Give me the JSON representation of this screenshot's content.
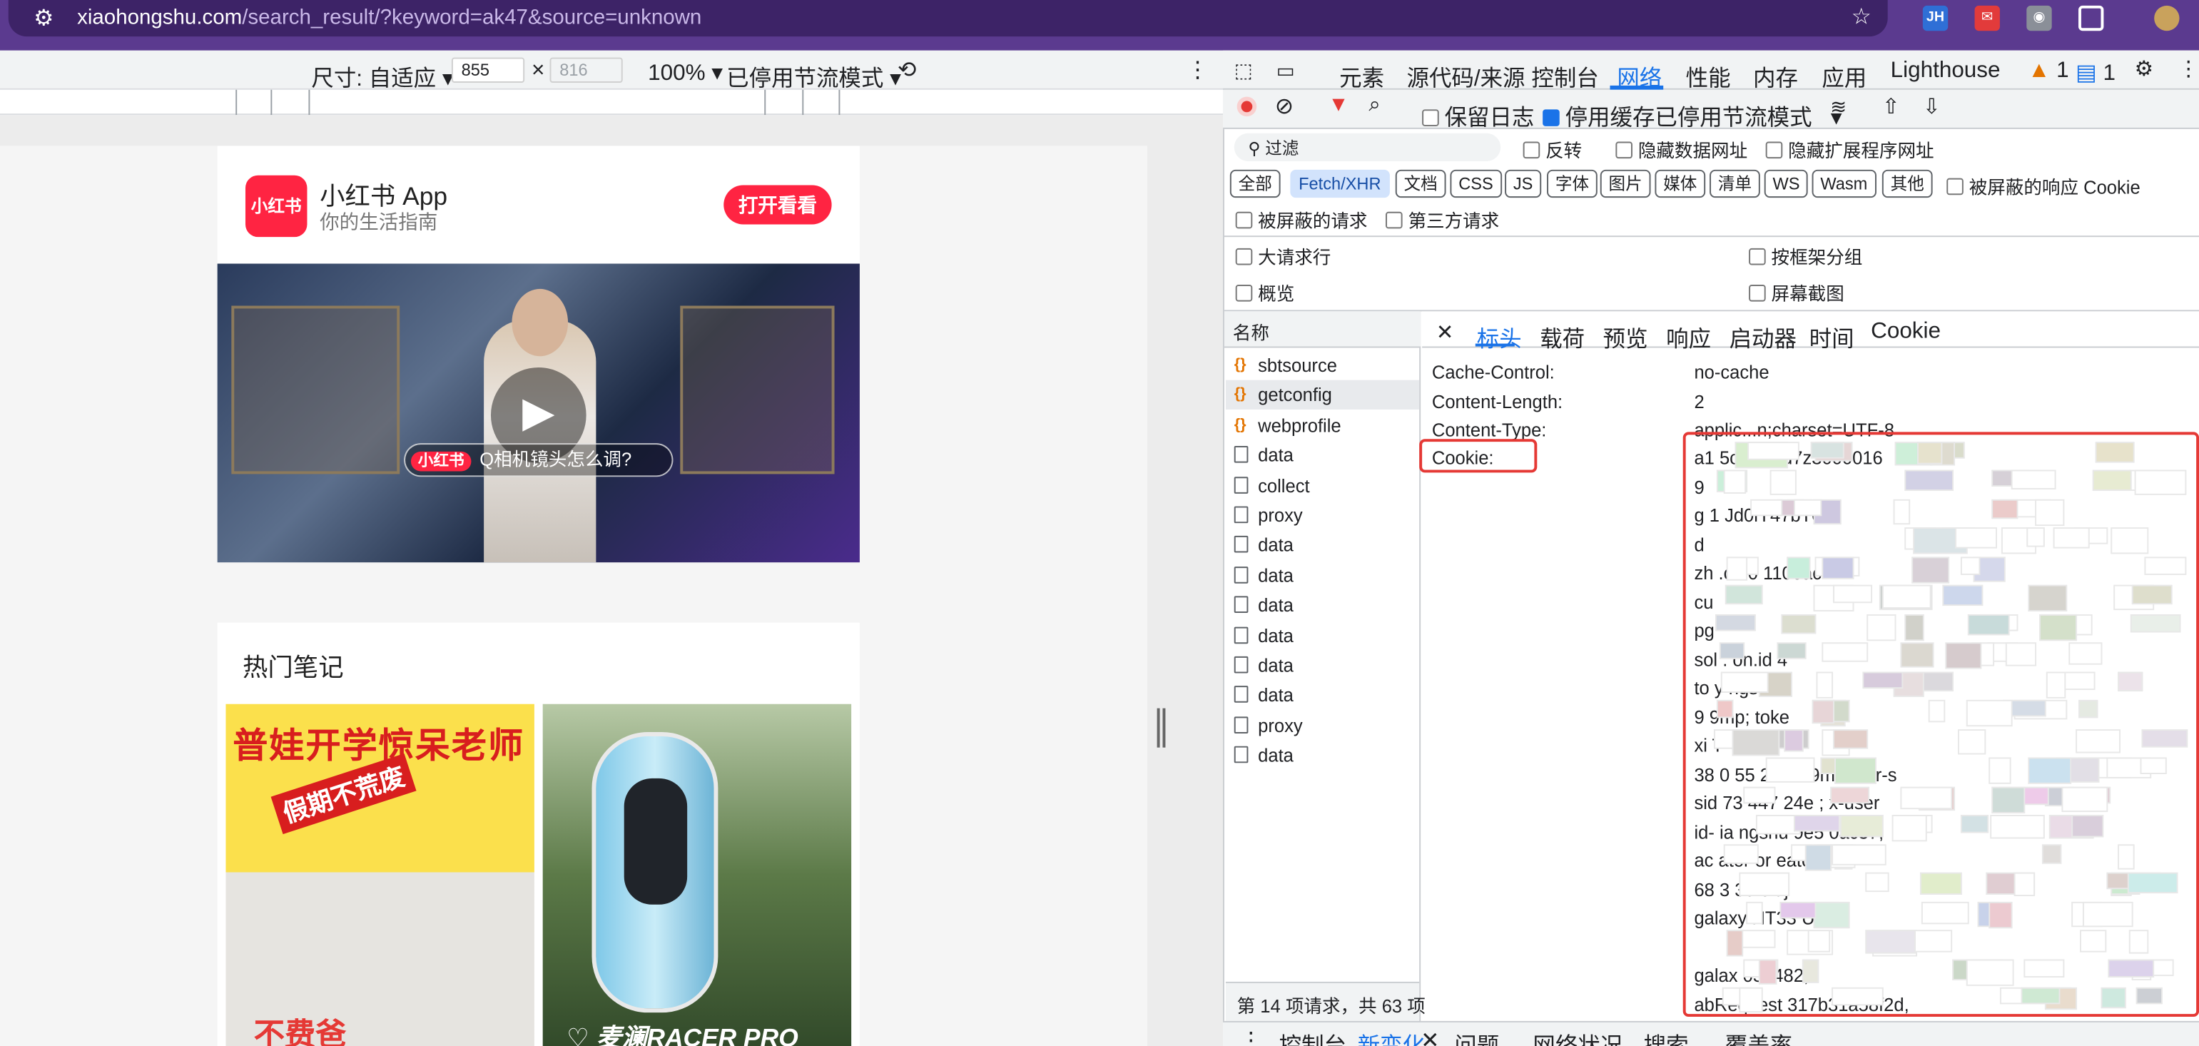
{
  "browser": {
    "url_host": "xiaohongshu.com",
    "url_path": "/search_result/?keyword=ak47&source=unknown",
    "extensions": [
      "JH"
    ],
    "star_icon": "bookmark-star-icon"
  },
  "device_toolbar": {
    "size_label": "尺寸: 自适应",
    "width": "855",
    "height": "816",
    "times": "×",
    "zoom": "100%",
    "throttle": "已停用节流模式"
  },
  "page": {
    "app_name": "小红书 App",
    "app_logo": "小红书",
    "app_sub": "你的生活指南",
    "open_button": "打开看看",
    "video_tag": "小红书",
    "video_query": "Q相机镜头怎么调?",
    "hot_title": "热门笔记",
    "card1_title": "普娃开学惊呆老师",
    "card1_sticker": "假期不荒废",
    "card1_bottom": "不费爸",
    "card2_bottom": "♡ 麦澜RACER PRO"
  },
  "devtools": {
    "tabs": [
      "元素",
      "源代码/来源",
      "控制台",
      "网络",
      "性能",
      "内存",
      "应用",
      "Lighthouse"
    ],
    "warn_count": "1",
    "msg_count": "1",
    "preserve_log": "保留日志",
    "disable_cache": "停用缓存",
    "throttle": "已停用节流模式",
    "filter_placeholder": "过滤",
    "invert": "反转",
    "hide_data_urls": "隐藏数据网址",
    "hide_ext_urls": "隐藏扩展程序网址",
    "type_chips": [
      "全部",
      "Fetch/XHR",
      "文档",
      "CSS",
      "JS",
      "字体",
      "图片",
      "媒体",
      "清单",
      "WS",
      "Wasm",
      "其他"
    ],
    "blocked_cookies": "被屏蔽的响应 Cookie",
    "blocked_requests": "被屏蔽的请求",
    "third_party": "第三方请求",
    "big_rows": "大请求行",
    "group_by_frame": "按框架分组",
    "overview": "概览",
    "screenshots": "屏幕截图",
    "name_header": "名称",
    "requests": [
      {
        "name": "sbtsource",
        "type": "fetch"
      },
      {
        "name": "getconfig",
        "type": "fetch"
      },
      {
        "name": "webprofile",
        "type": "fetch"
      },
      {
        "name": "data",
        "type": "doc"
      },
      {
        "name": "collect",
        "type": "doc"
      },
      {
        "name": "proxy",
        "type": "doc"
      },
      {
        "name": "data",
        "type": "doc"
      },
      {
        "name": "data",
        "type": "doc"
      },
      {
        "name": "data",
        "type": "doc"
      },
      {
        "name": "data",
        "type": "doc"
      },
      {
        "name": "data",
        "type": "doc"
      },
      {
        "name": "data",
        "type": "doc"
      },
      {
        "name": "proxy",
        "type": "doc"
      },
      {
        "name": "data",
        "type": "doc"
      }
    ],
    "status": "第 14 项请求，共 63 项",
    "detail_tabs": [
      "标头",
      "载荷",
      "预览",
      "响应",
      "启动器",
      "时间",
      "Cookie"
    ],
    "headers": [
      {
        "key": "Cache-Control:",
        "value": "no-cache"
      },
      {
        "key": "Content-Length:",
        "value": "2"
      },
      {
        "key": "Content-Type:",
        "value": "applic...n;charset=UTF-8"
      },
      {
        "key": "Cookie:",
        "value": ""
      }
    ],
    "cookie_lines": [
      "a1                    5c         ck1bd7z3000016",
      "9",
      "g        1         Jd0lY47bT0K",
      "d",
      "zh                 .c             00     1100ac",
      "cu",
      "pg",
      "sol     .     on.id                         4",
      "to       y     ngs                             T-",
      "             9                              9mp;    toke",
      "             xi                                 T-",
      "38          0     55      241          k        9m        omer-s",
      "sid          73       447              24e              ; x-user",
      "id-            ia    ngshu              9e5            0ac37;",
      "ac          ator      or                          eator.AT-",
      "68               3         39               oidj",
      "galaxy                      HT33              U7SE",
      "",
      "galax                                                    035482;",
      "abRequest                        317b31a58f2d,"
    ],
    "drawer_tabs": [
      "控制台",
      "新变化",
      "问题",
      "网络状况",
      "搜索",
      "覆盖率"
    ]
  }
}
